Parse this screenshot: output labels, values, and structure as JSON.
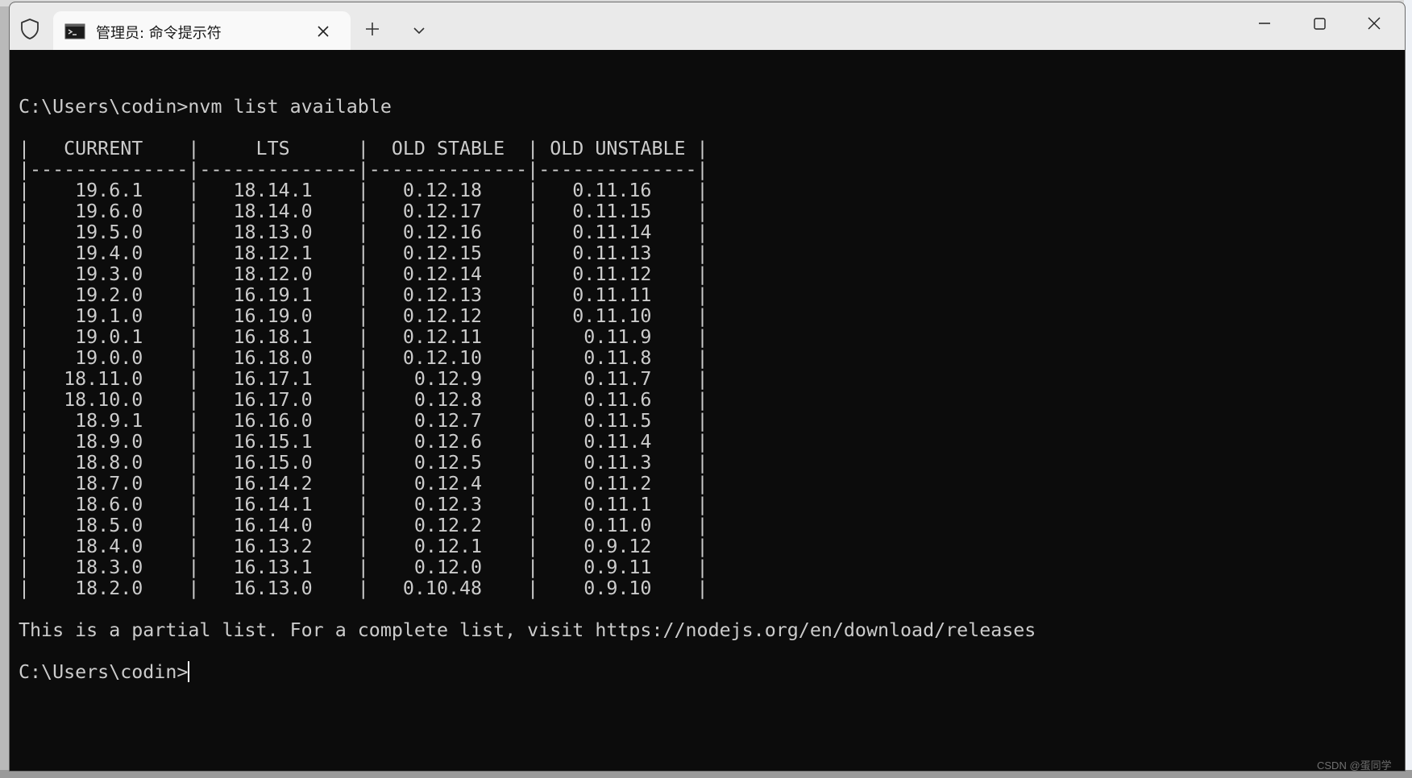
{
  "window": {
    "tab_title": "管理员: 命令提示符"
  },
  "terminal": {
    "prompt_command": "C:\\Users\\codin>nvm list available",
    "table_header": "|   CURRENT    |     LTS      |  OLD STABLE  | OLD UNSTABLE |",
    "table_separator": "|--------------|--------------|--------------|--------------|",
    "rows": [
      "|    19.6.1    |   18.14.1    |   0.12.18    |   0.11.16    |",
      "|    19.6.0    |   18.14.0    |   0.12.17    |   0.11.15    |",
      "|    19.5.0    |   18.13.0    |   0.12.16    |   0.11.14    |",
      "|    19.4.0    |   18.12.1    |   0.12.15    |   0.11.13    |",
      "|    19.3.0    |   18.12.0    |   0.12.14    |   0.11.12    |",
      "|    19.2.0    |   16.19.1    |   0.12.13    |   0.11.11    |",
      "|    19.1.0    |   16.19.0    |   0.12.12    |   0.11.10    |",
      "|    19.0.1    |   16.18.1    |   0.12.11    |    0.11.9    |",
      "|    19.0.0    |   16.18.0    |   0.12.10    |    0.11.8    |",
      "|   18.11.0    |   16.17.1    |    0.12.9    |    0.11.7    |",
      "|   18.10.0    |   16.17.0    |    0.12.8    |    0.11.6    |",
      "|    18.9.1    |   16.16.0    |    0.12.7    |    0.11.5    |",
      "|    18.9.0    |   16.15.1    |    0.12.6    |    0.11.4    |",
      "|    18.8.0    |   16.15.0    |    0.12.5    |    0.11.3    |",
      "|    18.7.0    |   16.14.2    |    0.12.4    |    0.11.2    |",
      "|    18.6.0    |   16.14.1    |    0.12.3    |    0.11.1    |",
      "|    18.5.0    |   16.14.0    |    0.12.2    |    0.11.0    |",
      "|    18.4.0    |   16.13.2    |    0.12.1    |    0.9.12    |",
      "|    18.3.0    |   16.13.1    |    0.12.0    |    0.9.11    |",
      "|    18.2.0    |   16.13.0    |   0.10.48    |    0.9.10    |"
    ],
    "footer_note": "This is a partial list. For a complete list, visit https://nodejs.org/en/download/releases",
    "prompt_idle": "C:\\Users\\codin>"
  },
  "watermark": "CSDN @蛋同学"
}
